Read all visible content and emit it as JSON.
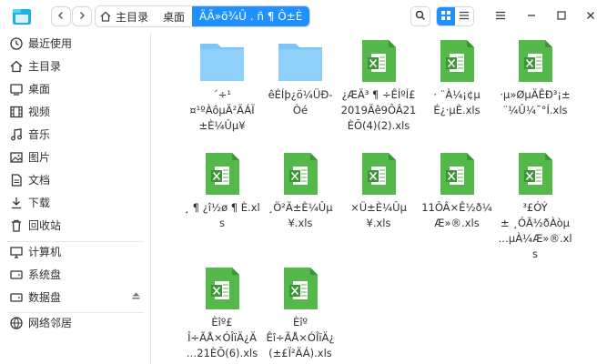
{
  "toolbar": {
    "back_label": "<",
    "forward_label": ">"
  },
  "breadcrumb": {
    "items": [
      "主目录",
      "桌面",
      "ÄÃ»õ¾Û . ñ ¶ Ô±È"
    ]
  },
  "sidebar": {
    "items": [
      {
        "label": "最近使用",
        "icon": "clock-icon"
      },
      {
        "label": "主目录",
        "icon": "home-icon"
      },
      {
        "label": "桌面",
        "icon": "desktop-icon"
      },
      {
        "label": "视频",
        "icon": "video-icon"
      },
      {
        "label": "音乐",
        "icon": "music-icon"
      },
      {
        "label": "图片",
        "icon": "picture-icon"
      },
      {
        "label": "文档",
        "icon": "document-icon"
      },
      {
        "label": "下载",
        "icon": "download-icon"
      },
      {
        "label": "回收站",
        "icon": "trash-icon"
      },
      {
        "label": "计算机",
        "icon": "computer-icon"
      },
      {
        "label": "系统盘",
        "icon": "disk-icon"
      },
      {
        "label": "数据盘",
        "icon": "disk-icon"
      },
      {
        "label": "网络邻居",
        "icon": "network-icon"
      }
    ]
  },
  "files": [
    {
      "type": "folder",
      "name": "´÷¹\n¤¹ºÀôµÄ²ÄÁÏ\n±È¼Ûµ¥"
    },
    {
      "type": "folder",
      "name": "êÉÍþ¿ö¼ÜÐ-\nÒé"
    },
    {
      "type": "excel",
      "name": "¿ÆÄ³ ¶ ÷ÊÍºÍ£\n2019Äê9ÔÂ21\nÈÕ(4)(2).xls"
    },
    {
      "type": "excel",
      "name": "· ¨À¼¡¢µ\nÉ¿·µÈ.xls"
    },
    {
      "type": "excel",
      "name": "·µ»ØµÄÊÐ³¡±\n¨¼Û¼¯°Í.xls"
    },
    {
      "type": "excel",
      "name": "¸ ¶ ¿î½ø ¶ È.xl\ns"
    },
    {
      "type": "excel",
      "name": "¸Ö²Ä±È¼Ûµ\n¥.xls"
    },
    {
      "type": "excel",
      "name": "×Ü±È¼Ûµ\n¥.xls"
    },
    {
      "type": "excel",
      "name": "11ÔÂ×Ê½ð¼\nÆ»®.xls"
    },
    {
      "type": "excel",
      "name": "³£ÓÝ\n± ¸ÓÃ½ðÀòµ\n…µÀ¼Æ»®.xls"
    },
    {
      "type": "excel",
      "name": "Èîº£\nÎ÷ÃÅ×ÓÎïÄ¿Ä\n…21ÈÕ(6).xls"
    },
    {
      "type": "excel",
      "name": "Èîº\nÊî÷ÃÅ×ÓÎïÄ¿\n(±£Ï²ÄÁ).xls"
    }
  ]
}
